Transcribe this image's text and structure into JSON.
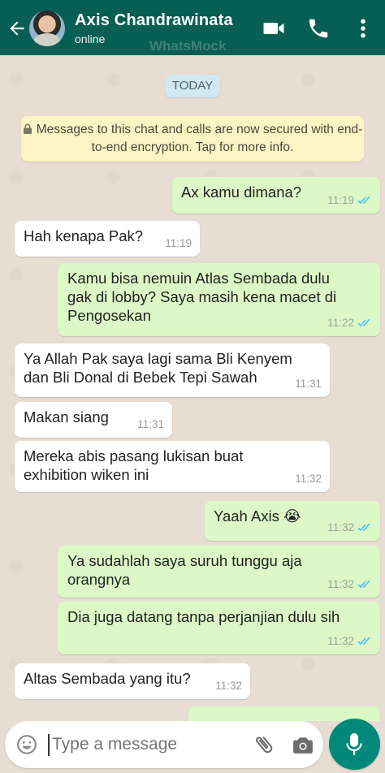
{
  "header": {
    "contact_name": "Axis Chandrawinata",
    "status": "online",
    "watermark": "WhatsMock"
  },
  "chat": {
    "date_label": "TODAY",
    "notice": "Messages to this chat and calls are now secured with end-to-end encryption. Tap for more info.",
    "messages": [
      {
        "dir": "out",
        "text": "Ax kamu dimana?",
        "time": "11:19"
      },
      {
        "dir": "in",
        "text": "Hah kenapa Pak?",
        "time": "11:19"
      },
      {
        "dir": "out",
        "text": "Kamu bisa nemuin Atlas Sembada dulu gak di lobby? Saya masih kena macet di Pengosekan",
        "time": "11:22"
      },
      {
        "dir": "in",
        "text": "Ya Allah Pak saya lagi sama Bli Kenyem dan Bli Donal di Bebek Tepi Sawah",
        "time": "11:31"
      },
      {
        "dir": "in",
        "text": "Makan siang",
        "time": "11:31"
      },
      {
        "dir": "in",
        "text": "Mereka abis pasang lukisan buat exhibition wiken ini",
        "time": "11:32"
      },
      {
        "dir": "out",
        "text": "Yaah Axis 😭",
        "time": "11:32"
      },
      {
        "dir": "out",
        "text": "Ya sudahlah saya suruh tunggu aja orangnya",
        "time": "11:32"
      },
      {
        "dir": "out",
        "text": "Dia juga datang tanpa perjanjian dulu sih",
        "time": "11:32"
      },
      {
        "dir": "in",
        "text": "Altas Sembada yang itu?",
        "time": "11:32"
      }
    ]
  },
  "input": {
    "placeholder": "Type a message"
  },
  "icons": {
    "back": "arrow-left-icon",
    "video": "video-camera-icon",
    "call": "phone-icon",
    "more": "more-vertical-icon",
    "lock": "lock-icon",
    "read": "double-check-icon",
    "emoji": "emoji-icon",
    "attach": "paperclip-icon",
    "camera": "camera-icon",
    "mic": "microphone-icon"
  },
  "colors": {
    "header": "#075e54",
    "outgoing_bubble": "#dcf8c6",
    "incoming_bubble": "#ffffff",
    "read_ticks": "#4fc3f7",
    "mic_button": "#00897b"
  }
}
